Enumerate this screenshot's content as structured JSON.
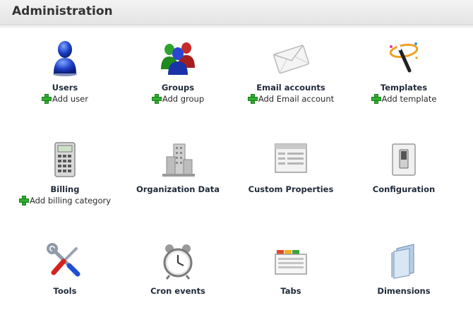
{
  "page": {
    "title": "Administration"
  },
  "items": [
    {
      "name": "users",
      "title": "Users",
      "add": "Add user",
      "icon": "user-icon"
    },
    {
      "name": "groups",
      "title": "Groups",
      "add": "Add group",
      "icon": "group-icon"
    },
    {
      "name": "email-accounts",
      "title": "Email accounts",
      "add": "Add Email account",
      "icon": "envelope-icon"
    },
    {
      "name": "templates",
      "title": "Templates",
      "add": "Add template",
      "icon": "magic-wand-icon"
    },
    {
      "name": "billing",
      "title": "Billing",
      "add": "Add billing category",
      "icon": "calculator-icon"
    },
    {
      "name": "organization-data",
      "title": "Organization Data",
      "icon": "building-icon"
    },
    {
      "name": "custom-properties",
      "title": "Custom Properties",
      "icon": "form-window-icon"
    },
    {
      "name": "configuration",
      "title": "Configuration",
      "icon": "switch-icon"
    },
    {
      "name": "tools",
      "title": "Tools",
      "icon": "tools-icon"
    },
    {
      "name": "cron-events",
      "title": "Cron events",
      "icon": "alarm-clock-icon"
    },
    {
      "name": "tabs",
      "title": "Tabs",
      "icon": "tabbed-window-icon"
    },
    {
      "name": "dimensions",
      "title": "Dimensions",
      "icon": "folder-icon"
    }
  ]
}
